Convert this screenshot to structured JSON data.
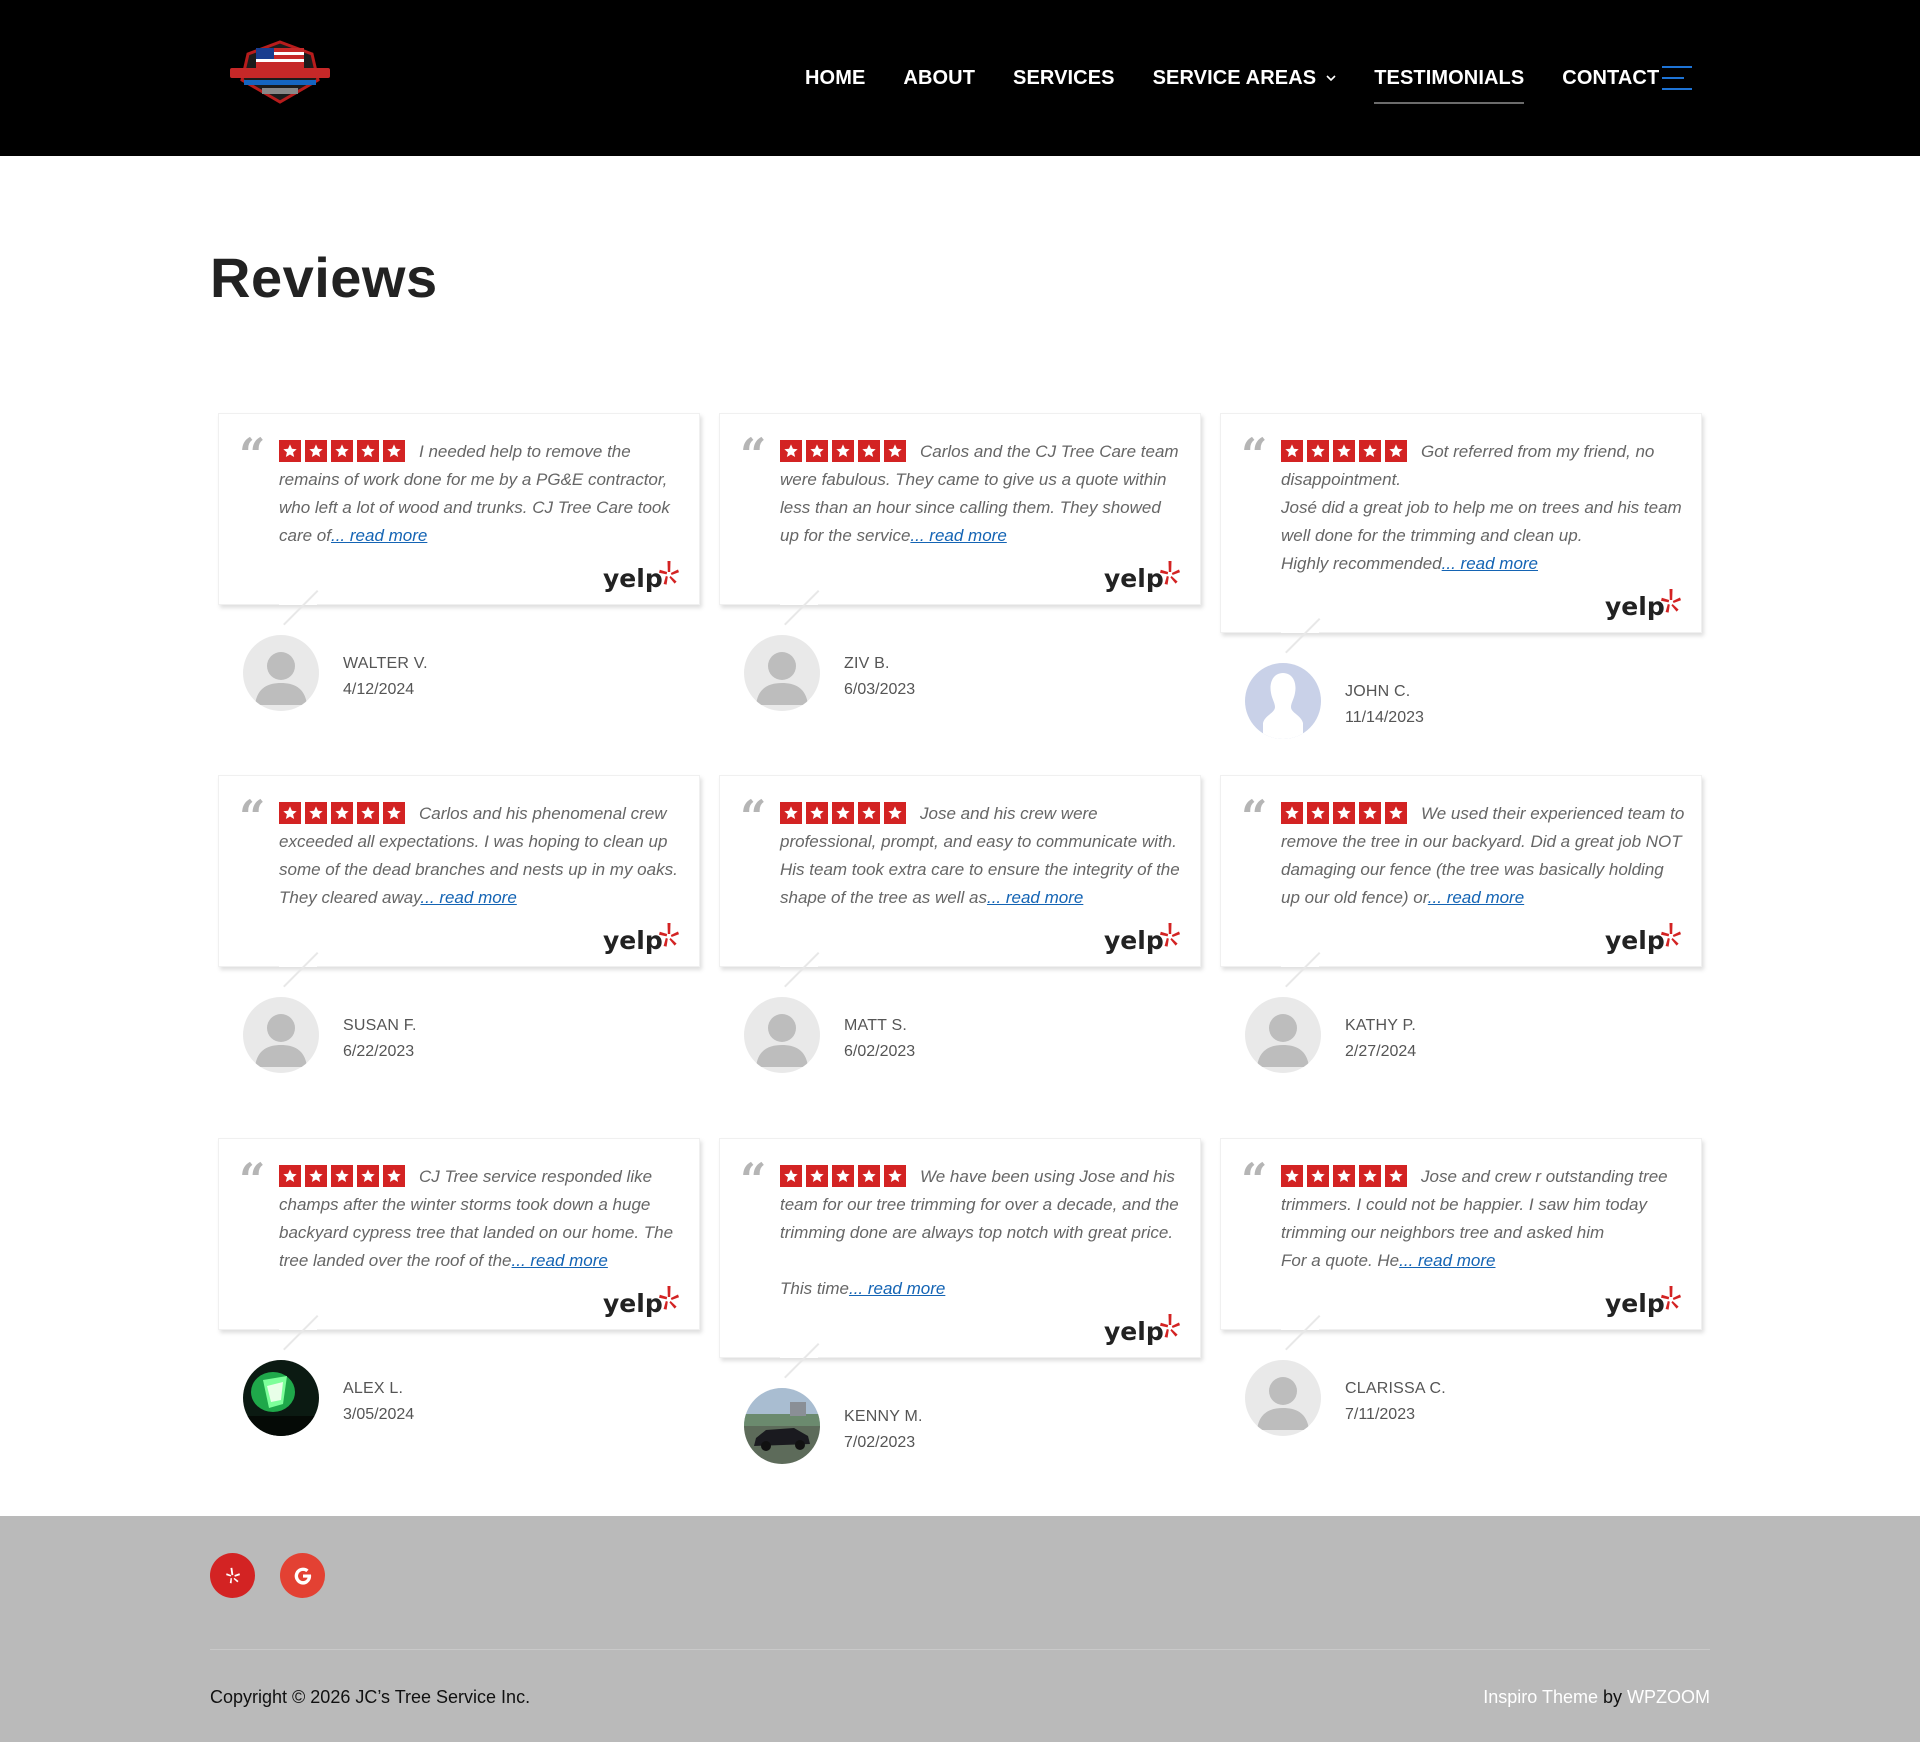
{
  "header": {
    "nav": [
      {
        "label": "HOME",
        "active": false
      },
      {
        "label": "ABOUT",
        "active": false
      },
      {
        "label": "SERVICES",
        "active": false
      },
      {
        "label": "SERVICE AREAS",
        "active": false
      },
      {
        "label": "TESTIMONIALS",
        "active": true
      },
      {
        "label": "CONTACT",
        "active": false
      }
    ]
  },
  "page": {
    "title": "Reviews"
  },
  "colors": {
    "star": "#d32323",
    "link": "#1464b4",
    "menu_icon": "#1e74d6",
    "footer_bg": "#bababa"
  },
  "reviews": [
    {
      "text": "I needed help to remove the remains of work done for me by a PG&E contractor, who left a lot of wood and trunks. CJ Tree Care took care of",
      "more": "... read more",
      "name": "WALTER V.",
      "date": "4/12/2024",
      "rating": 5,
      "avatar": "default"
    },
    {
      "text": "Carlos and the CJ Tree Care team were fabulous. They came to give us a quote within less than an hour since calling them. They showed up for the service",
      "more": "... read more",
      "name": "ZIV B.",
      "date": "6/03/2023",
      "rating": 5,
      "avatar": "default"
    },
    {
      "text": "Got referred from my friend, no disappointment.",
      "text2": "José did a great job to help me on trees and his team well done for the trimming and clean up.",
      "text3": "Highly recommended",
      "more": "... read more",
      "name": "JOHN C.",
      "date": "11/14/2023",
      "rating": 5,
      "avatar": "silhouette"
    },
    {
      "text": "Carlos and his phenomenal crew exceeded all expectations. I was hoping to clean up some of the dead branches and nests up in my oaks. They cleared away",
      "more": "... read more",
      "name": "SUSAN F.",
      "date": "6/22/2023",
      "rating": 5,
      "avatar": "default"
    },
    {
      "text": "Jose and his crew were professional, prompt, and easy to communicate with. His team took extra care to ensure the integrity of the shape of the tree as well as",
      "more": "... read more",
      "name": "MATT S.",
      "date": "6/02/2023",
      "rating": 5,
      "avatar": "default"
    },
    {
      "text": "We used their experienced team to remove the tree in our backyard. Did a great job NOT damaging our fence (the tree was basically holding up our old fence) or",
      "more": "... read more",
      "name": "KATHY P.",
      "date": "2/27/2024",
      "rating": 5,
      "avatar": "default"
    },
    {
      "text": "CJ Tree service responded like champs after the winter storms took down a huge backyard cypress tree that landed on our home. The tree landed over the roof of the",
      "more": "... read more",
      "name": "ALEX L.",
      "date": "3/05/2024",
      "rating": 5,
      "avatar": "green-photo"
    },
    {
      "text": "We have been using Jose and his team for our tree trimming for over a decade, and the trimming done are always top notch with great price.",
      "text2": "This time",
      "more": "... read more",
      "name": "KENNY M.",
      "date": "7/02/2023",
      "rating": 5,
      "avatar": "car-photo"
    },
    {
      "text": "Jose and crew r outstanding tree trimmers. I could not be happier. I saw him today trimming our neighbors tree and asked him",
      "text2": "For a quote. He",
      "more": "... read more",
      "name": "CLARISSA C.",
      "date": "7/11/2023",
      "rating": 5,
      "avatar": "default"
    }
  ],
  "footer": {
    "copyright": "Copyright © 2026 JC’s Tree Service Inc.",
    "theme": "Inspiro Theme",
    "by": " by ",
    "author": "WPZOOM",
    "social": [
      "yelp-icon",
      "google-icon"
    ]
  }
}
